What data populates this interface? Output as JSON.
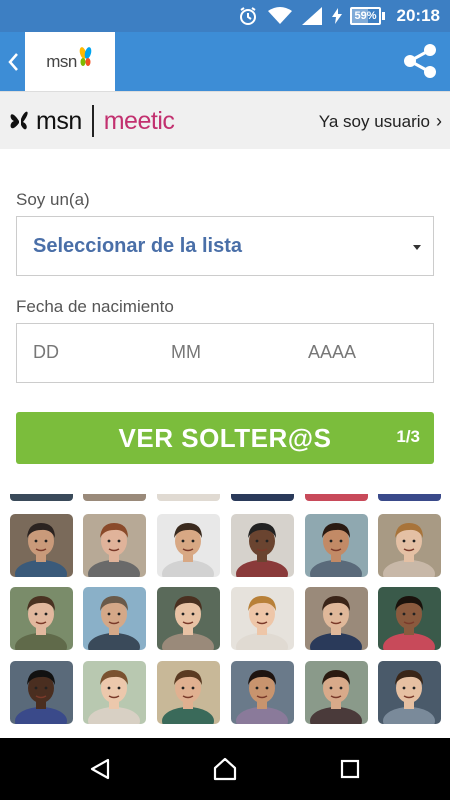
{
  "status_bar": {
    "battery_text": "59%",
    "battery_level": 0.59,
    "time": "20:18",
    "icons": [
      "alarm-icon",
      "wifi-icon",
      "signal-icon",
      "charging-icon",
      "battery-icon"
    ]
  },
  "app_bar": {
    "logo_text": "msn",
    "back_icon": "chevron-left-icon",
    "share_icon": "share-icon"
  },
  "brand_bar": {
    "msn_text": "msn",
    "meetic_text": "meetic",
    "login_link": "Ya soy usuario"
  },
  "form": {
    "gender_label": "Soy un(a)",
    "gender_select_value": "Seleccionar de la lista",
    "dob_label": "Fecha de nacimiento",
    "dob_day_placeholder": "DD",
    "dob_month_placeholder": "MM",
    "dob_year_placeholder": "AAAA",
    "cta_label": "VER SOLTER@S",
    "cta_step": "1/3"
  },
  "colors": {
    "status_bar": "#3d7fc3",
    "app_bar": "#3d8dd6",
    "cta": "#7bbd3c",
    "select_text": "#4a6fa8",
    "meetic_pink": "#c2306f"
  },
  "nav_bar": {
    "icons": [
      "back-triangle-icon",
      "home-icon",
      "recents-square-icon"
    ]
  }
}
